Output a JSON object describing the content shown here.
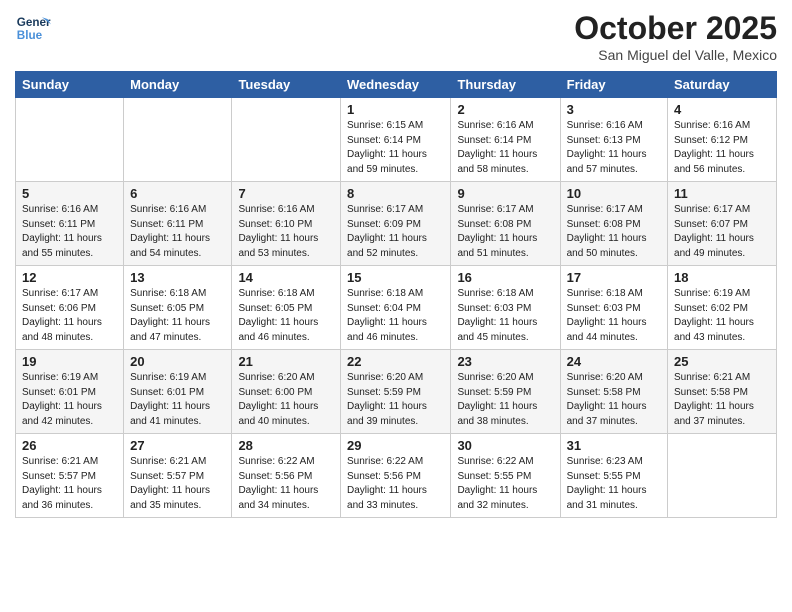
{
  "header": {
    "logo_line1": "General",
    "logo_line2": "Blue",
    "month_title": "October 2025",
    "location": "San Miguel del Valle, Mexico"
  },
  "weekdays": [
    "Sunday",
    "Monday",
    "Tuesday",
    "Wednesday",
    "Thursday",
    "Friday",
    "Saturday"
  ],
  "weeks": [
    [
      {
        "day": "",
        "info": ""
      },
      {
        "day": "",
        "info": ""
      },
      {
        "day": "",
        "info": ""
      },
      {
        "day": "1",
        "info": "Sunrise: 6:15 AM\nSunset: 6:14 PM\nDaylight: 11 hours\nand 59 minutes."
      },
      {
        "day": "2",
        "info": "Sunrise: 6:16 AM\nSunset: 6:14 PM\nDaylight: 11 hours\nand 58 minutes."
      },
      {
        "day": "3",
        "info": "Sunrise: 6:16 AM\nSunset: 6:13 PM\nDaylight: 11 hours\nand 57 minutes."
      },
      {
        "day": "4",
        "info": "Sunrise: 6:16 AM\nSunset: 6:12 PM\nDaylight: 11 hours\nand 56 minutes."
      }
    ],
    [
      {
        "day": "5",
        "info": "Sunrise: 6:16 AM\nSunset: 6:11 PM\nDaylight: 11 hours\nand 55 minutes."
      },
      {
        "day": "6",
        "info": "Sunrise: 6:16 AM\nSunset: 6:11 PM\nDaylight: 11 hours\nand 54 minutes."
      },
      {
        "day": "7",
        "info": "Sunrise: 6:16 AM\nSunset: 6:10 PM\nDaylight: 11 hours\nand 53 minutes."
      },
      {
        "day": "8",
        "info": "Sunrise: 6:17 AM\nSunset: 6:09 PM\nDaylight: 11 hours\nand 52 minutes."
      },
      {
        "day": "9",
        "info": "Sunrise: 6:17 AM\nSunset: 6:08 PM\nDaylight: 11 hours\nand 51 minutes."
      },
      {
        "day": "10",
        "info": "Sunrise: 6:17 AM\nSunset: 6:08 PM\nDaylight: 11 hours\nand 50 minutes."
      },
      {
        "day": "11",
        "info": "Sunrise: 6:17 AM\nSunset: 6:07 PM\nDaylight: 11 hours\nand 49 minutes."
      }
    ],
    [
      {
        "day": "12",
        "info": "Sunrise: 6:17 AM\nSunset: 6:06 PM\nDaylight: 11 hours\nand 48 minutes."
      },
      {
        "day": "13",
        "info": "Sunrise: 6:18 AM\nSunset: 6:05 PM\nDaylight: 11 hours\nand 47 minutes."
      },
      {
        "day": "14",
        "info": "Sunrise: 6:18 AM\nSunset: 6:05 PM\nDaylight: 11 hours\nand 46 minutes."
      },
      {
        "day": "15",
        "info": "Sunrise: 6:18 AM\nSunset: 6:04 PM\nDaylight: 11 hours\nand 46 minutes."
      },
      {
        "day": "16",
        "info": "Sunrise: 6:18 AM\nSunset: 6:03 PM\nDaylight: 11 hours\nand 45 minutes."
      },
      {
        "day": "17",
        "info": "Sunrise: 6:18 AM\nSunset: 6:03 PM\nDaylight: 11 hours\nand 44 minutes."
      },
      {
        "day": "18",
        "info": "Sunrise: 6:19 AM\nSunset: 6:02 PM\nDaylight: 11 hours\nand 43 minutes."
      }
    ],
    [
      {
        "day": "19",
        "info": "Sunrise: 6:19 AM\nSunset: 6:01 PM\nDaylight: 11 hours\nand 42 minutes."
      },
      {
        "day": "20",
        "info": "Sunrise: 6:19 AM\nSunset: 6:01 PM\nDaylight: 11 hours\nand 41 minutes."
      },
      {
        "day": "21",
        "info": "Sunrise: 6:20 AM\nSunset: 6:00 PM\nDaylight: 11 hours\nand 40 minutes."
      },
      {
        "day": "22",
        "info": "Sunrise: 6:20 AM\nSunset: 5:59 PM\nDaylight: 11 hours\nand 39 minutes."
      },
      {
        "day": "23",
        "info": "Sunrise: 6:20 AM\nSunset: 5:59 PM\nDaylight: 11 hours\nand 38 minutes."
      },
      {
        "day": "24",
        "info": "Sunrise: 6:20 AM\nSunset: 5:58 PM\nDaylight: 11 hours\nand 37 minutes."
      },
      {
        "day": "25",
        "info": "Sunrise: 6:21 AM\nSunset: 5:58 PM\nDaylight: 11 hours\nand 37 minutes."
      }
    ],
    [
      {
        "day": "26",
        "info": "Sunrise: 6:21 AM\nSunset: 5:57 PM\nDaylight: 11 hours\nand 36 minutes."
      },
      {
        "day": "27",
        "info": "Sunrise: 6:21 AM\nSunset: 5:57 PM\nDaylight: 11 hours\nand 35 minutes."
      },
      {
        "day": "28",
        "info": "Sunrise: 6:22 AM\nSunset: 5:56 PM\nDaylight: 11 hours\nand 34 minutes."
      },
      {
        "day": "29",
        "info": "Sunrise: 6:22 AM\nSunset: 5:56 PM\nDaylight: 11 hours\nand 33 minutes."
      },
      {
        "day": "30",
        "info": "Sunrise: 6:22 AM\nSunset: 5:55 PM\nDaylight: 11 hours\nand 32 minutes."
      },
      {
        "day": "31",
        "info": "Sunrise: 6:23 AM\nSunset: 5:55 PM\nDaylight: 11 hours\nand 31 minutes."
      },
      {
        "day": "",
        "info": ""
      }
    ]
  ]
}
